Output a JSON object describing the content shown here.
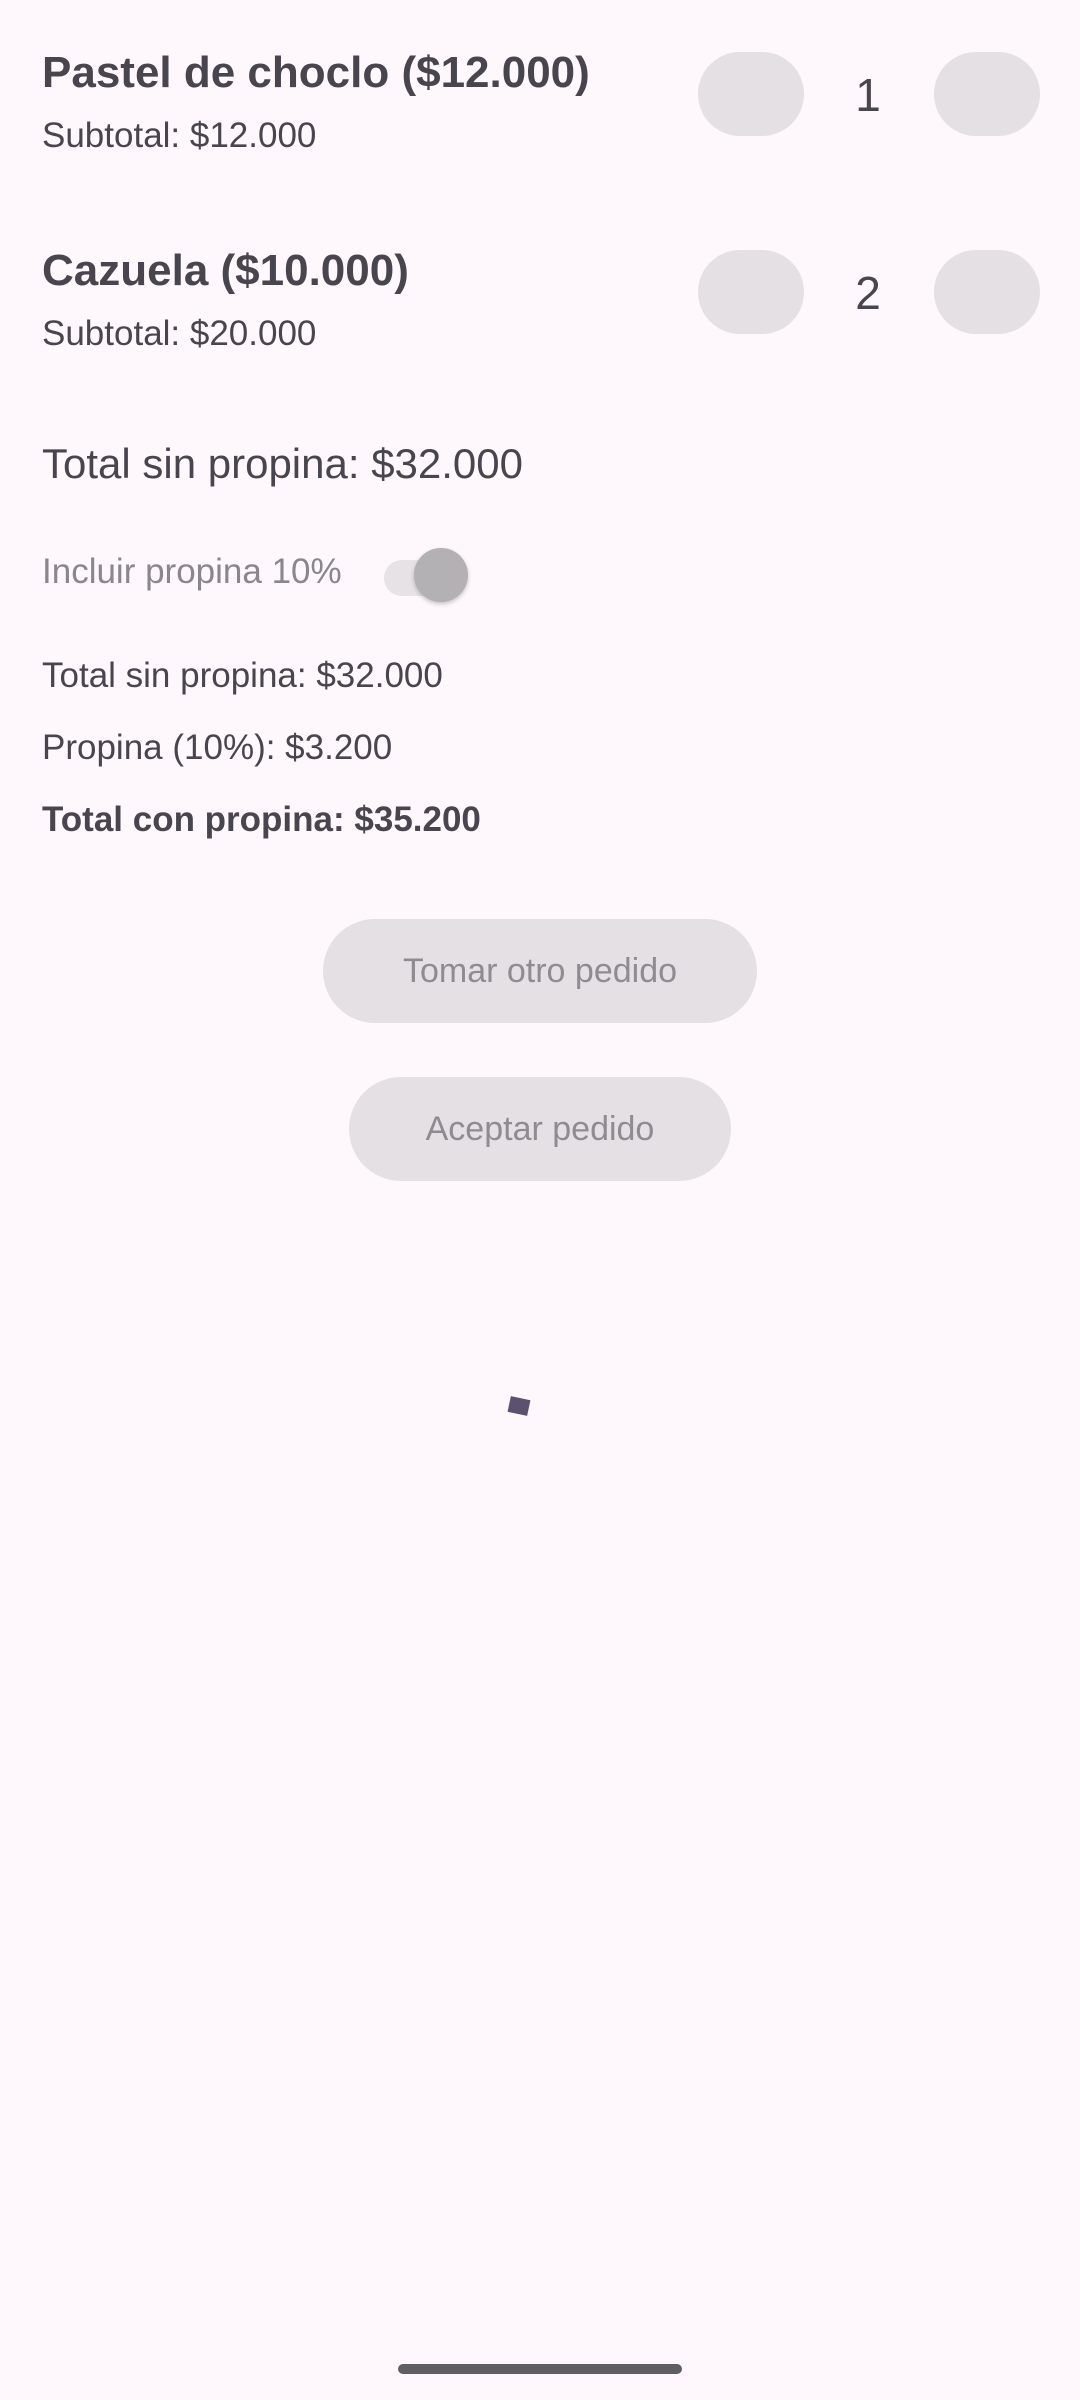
{
  "items": [
    {
      "name": "Pastel de choclo ($12.000)",
      "subtotal": "Subtotal: $12.000",
      "quantity": "1"
    },
    {
      "name": "Cazuela ($10.000)",
      "subtotal": "Subtotal: $20.000",
      "quantity": "2"
    }
  ],
  "total_without_tip": "Total sin propina: $32.000",
  "tip_toggle": {
    "label": "Incluir propina 10%",
    "checked": true
  },
  "summary": {
    "without_tip": "Total sin propina: $32.000",
    "tip": "Propina (10%): $3.200",
    "with_tip": "Total con propina: $35.200"
  },
  "buttons": {
    "new_order": "Tomar otro pedido",
    "accept_order": "Aceptar pedido"
  },
  "colors": {
    "background": "#fef7fb",
    "button_disabled": "#e4e0e4",
    "text": "#49454f",
    "spinner": "#5c5270"
  }
}
